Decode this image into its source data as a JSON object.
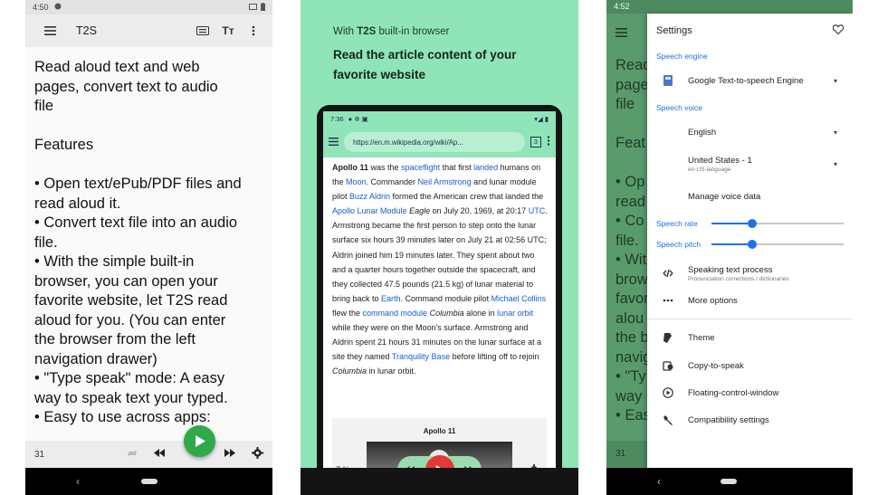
{
  "panel1": {
    "status_time": "4:50",
    "app_title": "T2S",
    "content_lines": [
      "Read aloud text and web",
      "pages, convert text to audio",
      "file",
      "",
      "Features",
      "",
      "• Open text/ePub/PDF files and",
      "read aloud it.",
      "• Convert text file into an audio",
      "file.",
      "• With the simple built-in",
      "browser, you can open your",
      "favorite website, let T2S read",
      "aloud for you. (You can enter",
      "the browser from the left",
      "navigation drawer)",
      "• \"Type speak\" mode: A easy",
      "way to speak text your typed.",
      "• Easy to use across apps:"
    ],
    "page_number": "31",
    "play_color": "#2eaa4a"
  },
  "panel2": {
    "caption_prefix": "With ",
    "caption_bold": "T2S",
    "caption_suffix": " built-in browser",
    "headline": "Read the article content of your favorite website",
    "status_time": "7:36",
    "url": "https://en.m.wikipedia.org/wiki/Ap...",
    "tab_count": "3",
    "media_title": "Apollo 11",
    "progress_label": "7 %",
    "bg_color": "#8fe5b8",
    "link_color": "#1a5bd6"
  },
  "panel3": {
    "status_time": "4:52",
    "bg_lines": [
      "Read",
      "page",
      "file",
      "",
      "Feat",
      "",
      "• Op",
      "read",
      "• Co",
      "file.",
      "• Wit",
      "brow",
      "favor",
      "alou",
      "the b",
      "navig",
      "• \"Ty",
      "way",
      "• Eas"
    ],
    "bg_page_number": "31",
    "drawer_title": "Settings",
    "speech_engine_label": "Speech engine",
    "engine_value": "Google Text-to-speech Engine",
    "speech_voice_label": "Speech voice",
    "language_value": "English",
    "region_value": "United States - 1",
    "region_sub": "en-US-language",
    "manage_voice": "Manage voice data",
    "speech_rate_label": "Speech rate",
    "speech_rate_value": 0.31,
    "speech_pitch_label": "Speech pitch",
    "speech_pitch_value": 0.31,
    "speaking_process": "Speaking text process",
    "speaking_process_sub": "Pronunciation corrections / dictionaries",
    "more_options": "More options",
    "theme": "Theme",
    "copy_to_speak": "Copy-to-speak",
    "floating_window": "Floating-control-window",
    "compat": "Compatibility settings",
    "accent": "#1a73e8"
  }
}
